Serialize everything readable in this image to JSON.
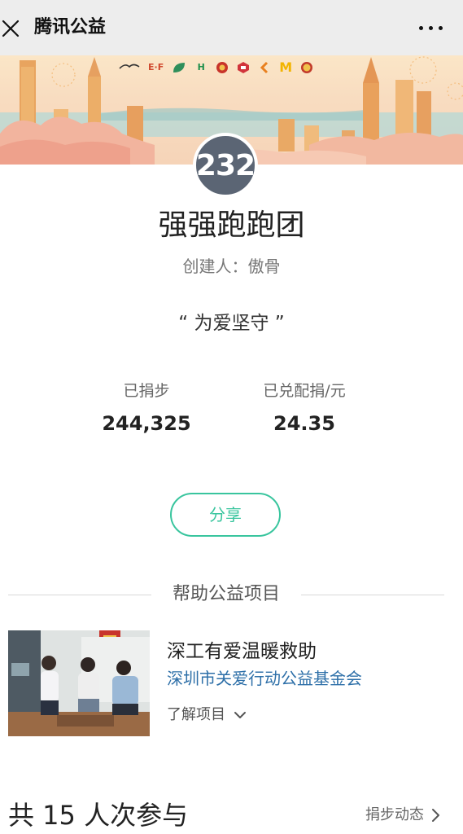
{
  "header": {
    "title": "腾讯公益",
    "close_icon": "close-icon",
    "more_icon": "more-horizontal-icon"
  },
  "banner": {
    "sponsor_marks": [
      "",
      "E·F",
      "",
      "H",
      "",
      "",
      "",
      "M",
      ""
    ],
    "colors": {
      "sky": "#fbe6c7",
      "tower": "#e7a25c",
      "sea": "#b8d8d5",
      "cloud": "#f2b49e"
    }
  },
  "team": {
    "avatar_text": "232",
    "name": "强强跑跑团",
    "creator": "创建人：傲骨",
    "slogan": "“ 为爱坚守 ”"
  },
  "stats": {
    "donated_steps_label": "已捐步",
    "donated_steps_value": "244,325",
    "matched_label": "已兑配捐/元",
    "matched_value": "24.35"
  },
  "actions": {
    "share_label": "分享"
  },
  "project_section": {
    "title": "帮助公益项目",
    "project": {
      "title": "深工有爱温暖救助",
      "organization": "深圳市关爱行动公益基金会",
      "learn_more": "了解项目",
      "learn_more_icon": "chevron-down-icon"
    }
  },
  "footer": {
    "participants": "共 15 人次参与",
    "step_feed": "捐步动态",
    "step_feed_icon": "chevron-right-icon"
  },
  "colors": {
    "accent": "#39c59e",
    "link": "#2d6fa8",
    "avatar_bg": "#5b6574",
    "header_bg": "#ededed"
  }
}
